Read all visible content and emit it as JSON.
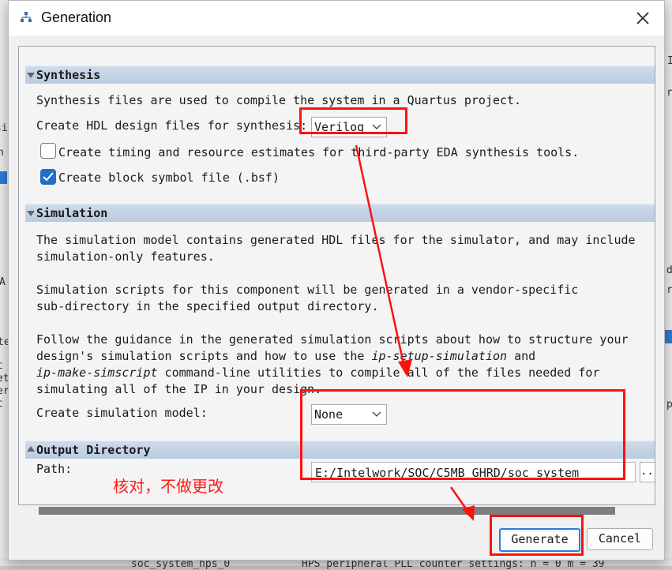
{
  "window": {
    "title": "Generation",
    "icon": "hierarchy-icon",
    "close_icon": "close-icon"
  },
  "synthesis": {
    "header": "Synthesis",
    "description": "Synthesis files are used to compile the system in a Quartus project.",
    "hdl_label": "Create HDL design files for synthesis:",
    "hdl_value": "Verilog",
    "timing_label": "Create timing and resource estimates for third-party EDA synthesis tools.",
    "timing_checked": false,
    "bsf_label": "Create block symbol file (.bsf)",
    "bsf_checked": true
  },
  "simulation": {
    "header": "Simulation",
    "para1_line1": "The simulation model contains generated HDL files for the simulator, and may include",
    "para1_line2": "simulation-only features.",
    "para2_line1": "Simulation scripts for this component will be generated in a vendor-specific",
    "para2_line2": "sub-directory in the specified output directory.",
    "para3_line1": "Follow the guidance in the generated simulation scripts about how to structure your",
    "para3_line2_a": "design's simulation scripts and how to use the ",
    "para3_line2_b": "ip-setup-simulation",
    "para3_line2_c": " and",
    "para3_line3_a": "ip-make-simscript",
    "para3_line3_b": " command-line utilities to compile all of the files needed for",
    "para3_line4": "simulating all of the IP in your design.",
    "model_label": "Create simulation model:",
    "model_value": "None"
  },
  "output": {
    "header": "Output Directory",
    "path_label": "Path:",
    "path_value": "E:/Intelwork/SOC/C5MB_GHRD/soc_system",
    "browse_label": "..."
  },
  "buttons": {
    "generate": "Generate",
    "cancel": "Cancel"
  },
  "annotation": {
    "text": "核对，不做更改",
    "color": "#ff1a1a"
  },
  "background": {
    "left_fragments": [
      "si",
      "h",
      "A",
      "te",
      "t",
      "et",
      "er",
      "t"
    ],
    "right_fragments": [
      "I",
      "r",
      "r",
      "d",
      "p"
    ],
    "bottom_left": "soc_system_hps_0",
    "bottom_right": "HPS peripheral PLL counter settings: n = 0 m = 39"
  },
  "colors": {
    "accent": "#1f6fc6",
    "section_header": "#c3d3e6",
    "annotation": "#ff1a1a"
  }
}
